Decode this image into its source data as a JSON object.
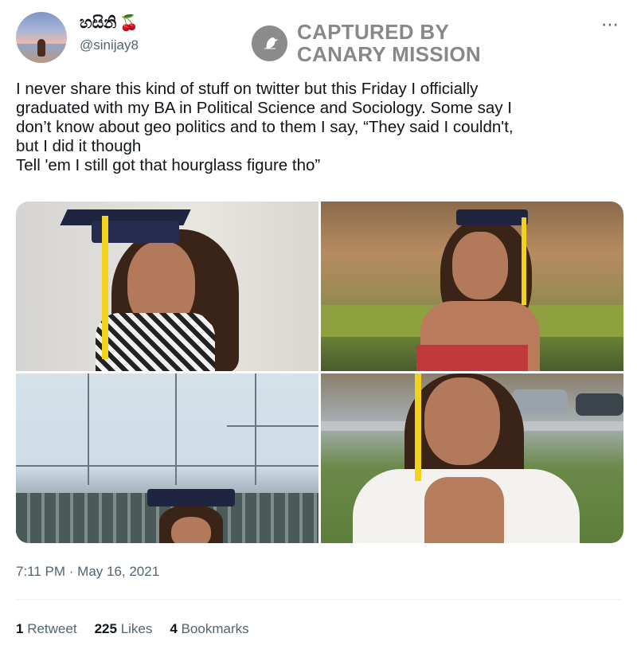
{
  "author": {
    "display_name": "හසිනි",
    "display_emoji": "🍒",
    "handle": "@sinijay8"
  },
  "watermark": {
    "line1": "CAPTURED BY",
    "line2": "CANARY MISSION"
  },
  "more_icon": "⋯",
  "tweet": {
    "text": "I never share this kind of stuff on twitter but this Friday I officially\ngraduated with my BA in Political Science and Sociology. Some say I\ndon’t know about geo politics and to them I say, “They said I couldn't,\nbut I did it though\nTell 'em I still got that hourglass figure tho”"
  },
  "media": {
    "photos": [
      {
        "name": "graduation-zoom-photo"
      },
      {
        "name": "graduation-tree-photo"
      },
      {
        "name": "graduation-building-photo"
      },
      {
        "name": "graduation-outdoor-photo"
      }
    ]
  },
  "timestamp": "7:11 PM · May 16, 2021",
  "stats": {
    "retweets_count": "1",
    "retweets_label": "Retweet",
    "likes_count": "225",
    "likes_label": "Likes",
    "bookmarks_count": "4",
    "bookmarks_label": "Bookmarks"
  },
  "icons": [
    "cherry-icon",
    "canary-logo-icon",
    "more-icon"
  ]
}
